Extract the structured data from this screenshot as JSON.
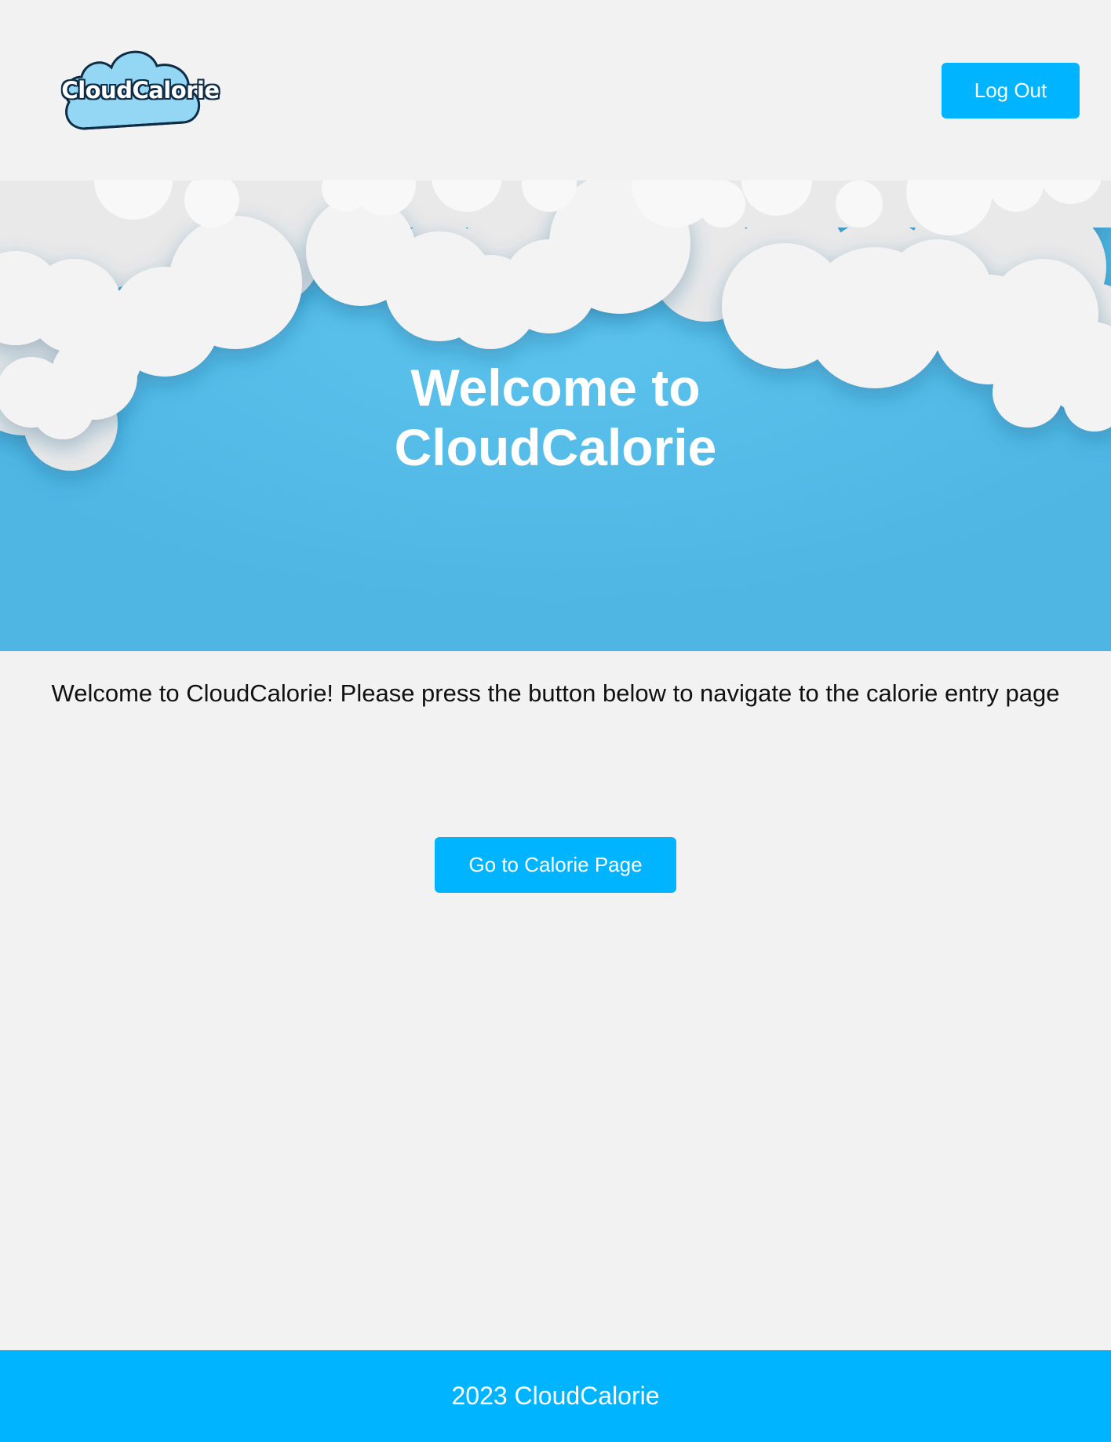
{
  "header": {
    "logo_text": "CloudCalorie",
    "logout_label": "Log Out"
  },
  "hero": {
    "title": "Welcome to CloudCalorie"
  },
  "main": {
    "intro_text": "Welcome to CloudCalorie! Please press the button below to navigate to the calorie entry page",
    "cta_label": "Go to Calorie Page"
  },
  "footer": {
    "text": "2023 CloudCalorie"
  },
  "colors": {
    "background": "#f2f2f2",
    "accent": "#00b4ff",
    "hero_sky": "#54bbe9",
    "cloud": "#f4f4f4"
  }
}
